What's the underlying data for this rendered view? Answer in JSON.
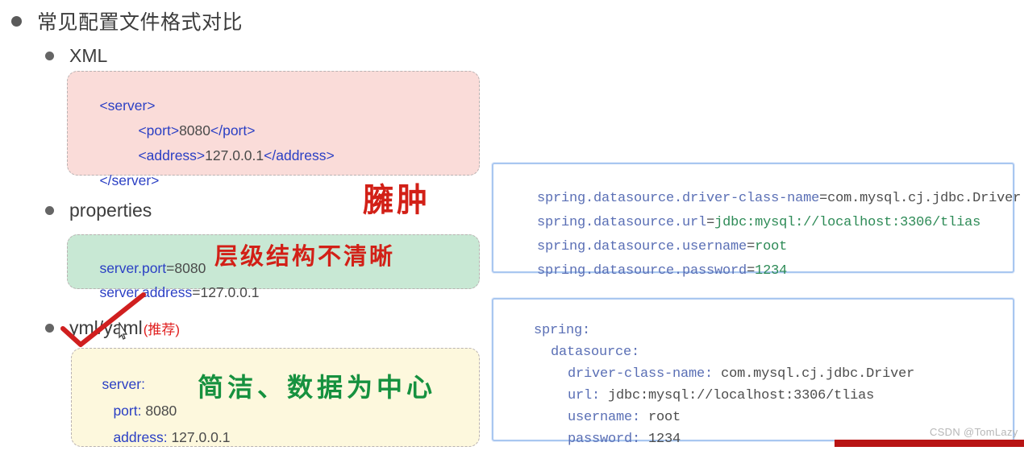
{
  "slide": {
    "title": "常见配置文件格式对比",
    "sections": [
      {
        "label": "XML"
      },
      {
        "label": "properties"
      },
      {
        "label": "yml/yaml",
        "suffix": "(推荐)"
      }
    ]
  },
  "xml_card": {
    "lines": [
      {
        "tag_open": "<server>"
      },
      {
        "tag_open": "<port>",
        "value": "8080",
        "tag_close": "</port>"
      },
      {
        "tag_open": "<address>",
        "value": "127.0.0.1",
        "tag_close": "</address>"
      },
      {
        "tag_open": "</server>"
      }
    ],
    "annotation": "臃肿",
    "annotation_color": "#d22017",
    "background": "#fadcd9"
  },
  "properties_card": {
    "lines": [
      {
        "key": "server.port",
        "sep": "=",
        "value": "8080"
      },
      {
        "key": "server.address",
        "sep": "=",
        "value": "127.0.0.1"
      }
    ],
    "annotation": "层级结构不清晰",
    "annotation_color": "#d22017",
    "background": "#c8e8d4"
  },
  "yaml_card": {
    "lines": [
      {
        "key": "server:",
        "value": ""
      },
      {
        "key": "port:",
        "value": "8080"
      },
      {
        "key": "address:",
        "value": "127.0.0.1"
      }
    ],
    "annotation": "简洁、数据为中心",
    "annotation_color": "#16913f",
    "background": "#fdf8dd"
  },
  "properties_panel": {
    "lines": [
      {
        "key": "spring.datasource.driver-class-name",
        "sep": "=",
        "value": "com.mysql.cj.jdbc.Driver"
      },
      {
        "key": "spring.datasource.url",
        "sep": "=",
        "value": "jdbc:mysql://localhost:3306/tlias"
      },
      {
        "key": "spring.datasource.username",
        "sep": "=",
        "value": "root"
      },
      {
        "key": "spring.datasource.password",
        "sep": "=",
        "value": "1234"
      }
    ]
  },
  "yaml_panel": {
    "lines": [
      {
        "indent": 0,
        "key": "spring:",
        "value": ""
      },
      {
        "indent": 1,
        "key": "datasource:",
        "value": ""
      },
      {
        "indent": 2,
        "key": "driver-class-name:",
        "value": "com.mysql.cj.jdbc.Driver"
      },
      {
        "indent": 2,
        "key": "url:",
        "value": "jdbc:mysql://localhost:3306/tlias"
      },
      {
        "indent": 2,
        "key": "username:",
        "value": "root"
      },
      {
        "indent": 2,
        "key": "password:",
        "value": "1234"
      }
    ]
  },
  "watermark": "CSDN @TomLazy",
  "accent": {
    "check_color": "#d01f1f",
    "panel_border": "#a9c7f0",
    "bottom_bar": "#b81414"
  }
}
